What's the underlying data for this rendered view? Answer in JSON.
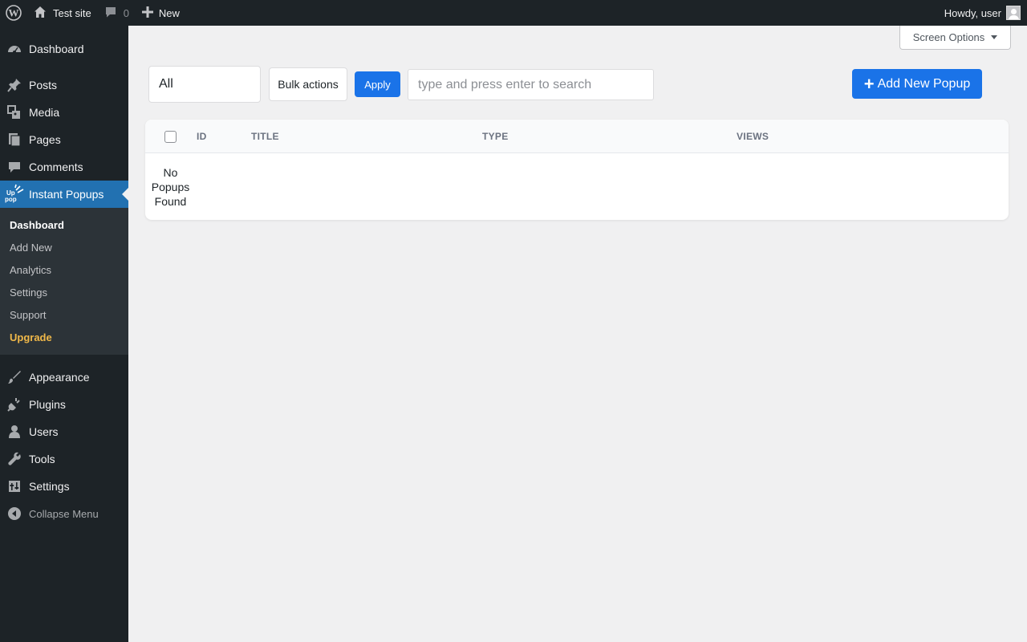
{
  "adminbar": {
    "site_name": "Test site",
    "comments_count": "0",
    "new_label": "New",
    "greeting": "Howdy, user"
  },
  "sidebar": {
    "items": [
      {
        "label": "Dashboard",
        "icon": "dashboard-icon"
      },
      {
        "label": "Posts",
        "icon": "pin-icon"
      },
      {
        "label": "Media",
        "icon": "media-icon"
      },
      {
        "label": "Pages",
        "icon": "pages-icon"
      },
      {
        "label": "Comments",
        "icon": "comment-icon"
      },
      {
        "label": "Instant Popups",
        "icon": "uppop-icon"
      }
    ],
    "submenu": [
      "Dashboard",
      "Add New",
      "Analytics",
      "Settings",
      "Support",
      "Upgrade"
    ],
    "items_after": [
      {
        "label": "Appearance",
        "icon": "brush-icon"
      },
      {
        "label": "Plugins",
        "icon": "plugin-icon"
      },
      {
        "label": "Users",
        "icon": "user-icon"
      },
      {
        "label": "Tools",
        "icon": "wrench-icon"
      },
      {
        "label": "Settings",
        "icon": "settings-icon"
      }
    ],
    "collapse_label": "Collapse Menu"
  },
  "screen_options": {
    "label": "Screen Options"
  },
  "toolbar": {
    "filter_value": "All",
    "bulk_label": "Bulk actions",
    "apply_label": "Apply",
    "search_placeholder": "type and press enter to search",
    "add_new_label": "Add New Popup"
  },
  "table": {
    "columns": [
      "ID",
      "TITLE",
      "TYPE",
      "VIEWS"
    ],
    "empty_line1": "No",
    "empty_line2": "Popups",
    "empty_line3": "Found"
  },
  "colors": {
    "adminbar_bg": "#1d2327",
    "accent": "#2271b1",
    "button_blue": "#1a73e8",
    "upgrade": "#f0b849"
  }
}
